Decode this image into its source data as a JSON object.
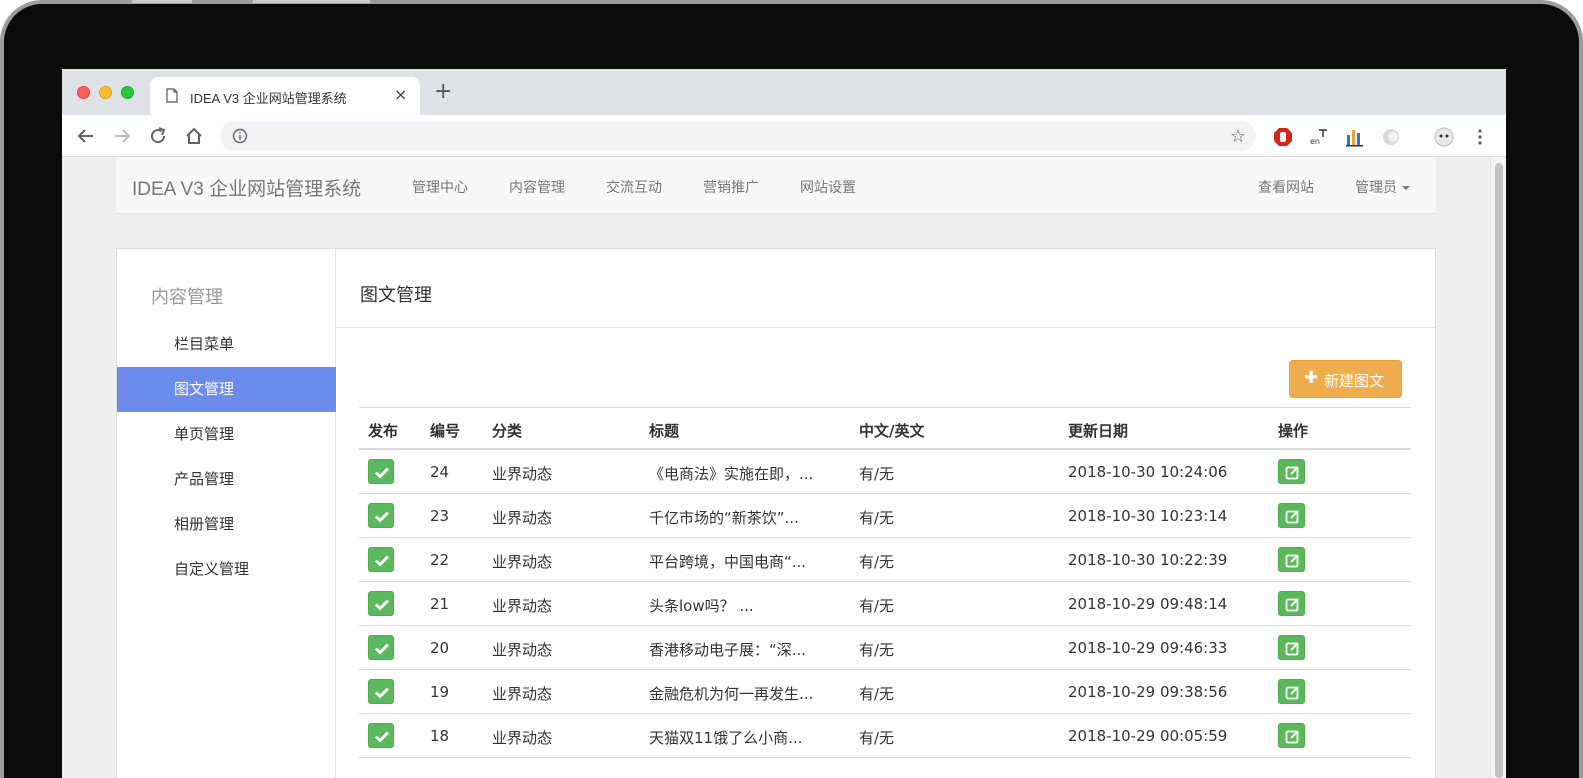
{
  "browser": {
    "tab_title": "IDEA V3 企业网站管理系统",
    "tab_close": "×",
    "new_tab": "+"
  },
  "navbar": {
    "brand": "IDEA V3 企业网站管理系统",
    "items": [
      "管理中心",
      "内容管理",
      "交流互动",
      "营销推广",
      "网站设置"
    ],
    "view_site": "查看网站",
    "admin": "管理员"
  },
  "sidebar": {
    "title": "内容管理",
    "items": [
      {
        "label": "栏目菜单",
        "active": false
      },
      {
        "label": "图文管理",
        "active": true
      },
      {
        "label": "单页管理",
        "active": false
      },
      {
        "label": "产品管理",
        "active": false
      },
      {
        "label": "相册管理",
        "active": false
      },
      {
        "label": "自定义管理",
        "active": false
      }
    ]
  },
  "content": {
    "title": "图文管理",
    "new_button": "新建图文",
    "columns": [
      "发布",
      "编号",
      "分类",
      "标题",
      "中文/英文",
      "更新日期",
      "操作"
    ],
    "rows": [
      {
        "published": true,
        "id": "24",
        "category": "业界动态",
        "title": "《电商法》实施在即，...",
        "lang": "有/无",
        "updated": "2018-10-30 10:24:06"
      },
      {
        "published": true,
        "id": "23",
        "category": "业界动态",
        "title": "千亿市场的“新茶饮”...",
        "lang": "有/无",
        "updated": "2018-10-30 10:23:14"
      },
      {
        "published": true,
        "id": "22",
        "category": "业界动态",
        "title": "平台跨境，中国电商“...",
        "lang": "有/无",
        "updated": "2018-10-30 10:22:39"
      },
      {
        "published": true,
        "id": "21",
        "category": "业界动态",
        "title": "头条low吗？ ...",
        "lang": "有/无",
        "updated": "2018-10-29 09:48:14"
      },
      {
        "published": true,
        "id": "20",
        "category": "业界动态",
        "title": "香港移动电子展：“深...",
        "lang": "有/无",
        "updated": "2018-10-29 09:46:33"
      },
      {
        "published": true,
        "id": "19",
        "category": "业界动态",
        "title": "金融危机为何一再发生...",
        "lang": "有/无",
        "updated": "2018-10-29 09:38:56"
      },
      {
        "published": true,
        "id": "18",
        "category": "业界动态",
        "title": "天猫双11饿了么小商...",
        "lang": "有/无",
        "updated": "2018-10-29 00:05:59"
      }
    ]
  },
  "colors": {
    "accent": "#6c8cec",
    "warning": "#f0ad4e",
    "success": "#5cb85c"
  }
}
